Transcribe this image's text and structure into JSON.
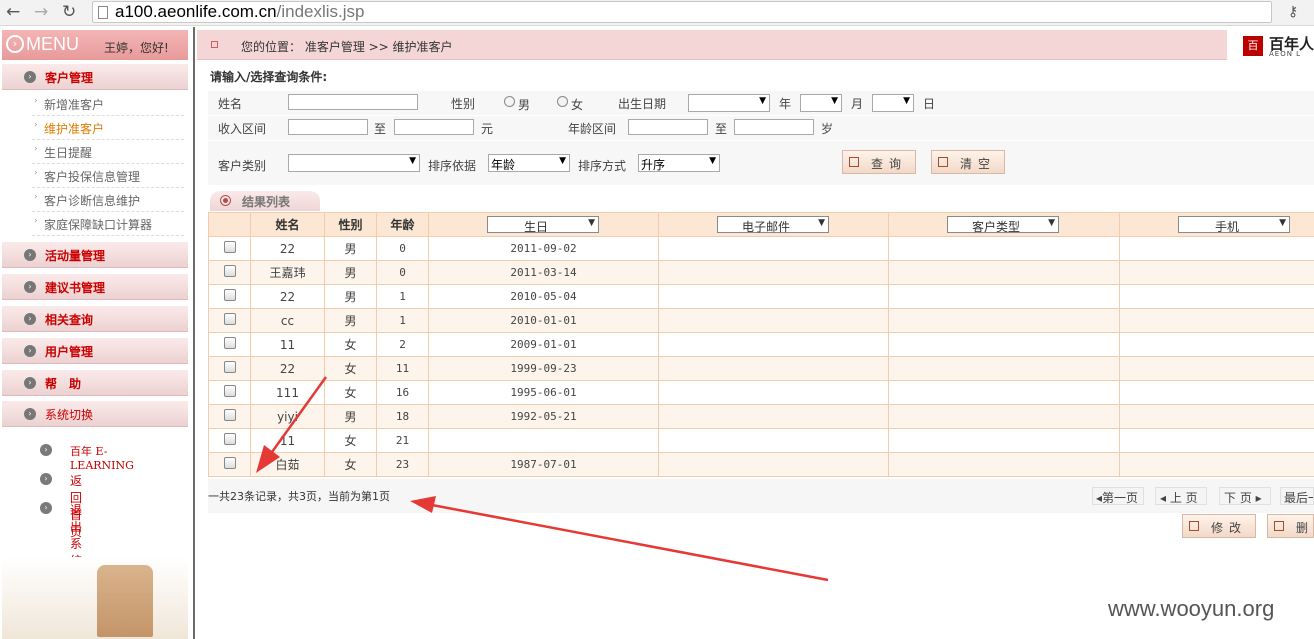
{
  "browser": {
    "back_icon": "back-arrow-icon",
    "forward_icon": "forward-arrow-icon",
    "reload_icon": "reload-icon",
    "url_domain": "a100.aeonlife.com.cn",
    "url_path": "/indexlis.jsp"
  },
  "sidebar": {
    "menu_title": "MENU",
    "user_greeting": "王婷，您好!",
    "groups": [
      {
        "label": "客户管理"
      },
      {
        "label": "活动量管理"
      },
      {
        "label": "建议书管理"
      },
      {
        "label": "相关查询"
      },
      {
        "label": "用户管理"
      },
      {
        "label": "帮　助"
      },
      {
        "label": "系统切换"
      }
    ],
    "sub_items": [
      {
        "label": "新增准客户"
      },
      {
        "label": "维护准客户"
      },
      {
        "label": "生日提醒"
      },
      {
        "label": "客户投保信息管理"
      },
      {
        "label": "客户诊断信息维护"
      },
      {
        "label": "家庭保障缺口计算器"
      }
    ],
    "links": [
      {
        "label": "百年 E-LEARNING"
      },
      {
        "label": "返回首页"
      },
      {
        "label": "退出系统"
      }
    ]
  },
  "breadcrumb": {
    "text": "您的位置：  准客户管理 >> 维护准客户"
  },
  "brand": {
    "name_cn": "百年人",
    "name_en": "AEON L"
  },
  "form": {
    "title": "请输入/选择查询条件:",
    "name_label": "姓名",
    "gender_label": "性别",
    "male": "男",
    "female": "女",
    "birth_label": "出生日期",
    "year": "年",
    "month": "月",
    "day": "日",
    "income_label": "收入区间",
    "to": "至",
    "yuan": "元",
    "age_label": "年龄区间",
    "age_unit": "岁",
    "type_label": "客户类别",
    "sort_by_label": "排序依据",
    "sort_by_value": "年龄",
    "sort_order_label": "排序方式",
    "sort_order_value": "升序",
    "query_button": "查询",
    "clear_button": "清空"
  },
  "results": {
    "tab_label": "结果列表",
    "columns": {
      "name": "姓名",
      "gender": "性别",
      "age": "年龄",
      "birthday": "生日",
      "email": "电子邮件",
      "customer_type": "客户类型",
      "mobile": "手机"
    },
    "rows": [
      {
        "name": "22",
        "gender": "男",
        "age": "0",
        "birthday": "2011-09-02"
      },
      {
        "name": "王嘉玮",
        "gender": "男",
        "age": "0",
        "birthday": "2011-03-14"
      },
      {
        "name": "22",
        "gender": "男",
        "age": "1",
        "birthday": "2010-05-04"
      },
      {
        "name": "cc",
        "gender": "男",
        "age": "1",
        "birthday": "2010-01-01"
      },
      {
        "name": "11",
        "gender": "女",
        "age": "2",
        "birthday": "2009-01-01"
      },
      {
        "name": "22",
        "gender": "女",
        "age": "11",
        "birthday": "1999-09-23"
      },
      {
        "name": "111",
        "gender": "女",
        "age": "16",
        "birthday": "1995-06-01"
      },
      {
        "name": "yiyi",
        "gender": "男",
        "age": "18",
        "birthday": "1992-05-21"
      },
      {
        "name": "11",
        "gender": "女",
        "age": "21",
        "birthday": ""
      },
      {
        "name": "白茹",
        "gender": "女",
        "age": "23",
        "birthday": "1987-07-01"
      }
    ],
    "record_info": "一共23条记录，共3页，当前为第1页"
  },
  "pagination": {
    "first": "◂第一页",
    "prev": "◂ 上 页",
    "next": "下 页 ▸",
    "last": "最后一"
  },
  "actions": {
    "edit_button": "修改",
    "delete_button": "删"
  },
  "watermark": "www.wooyun.org",
  "colors": {
    "accent_red": "#cc0000",
    "header_pink": "#f5d6d6",
    "annotation_arrow": "#e53935"
  }
}
